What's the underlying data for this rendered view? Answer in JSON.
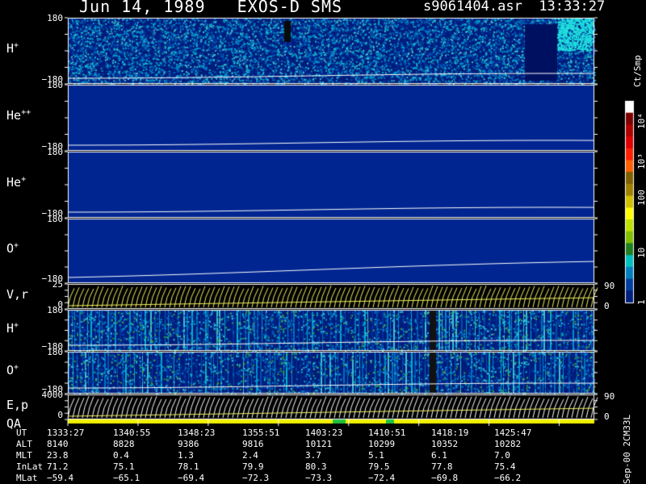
{
  "header": {
    "title": "Jun 14, 1989   EXOS-D SMS",
    "file": "s9061404.asr",
    "time": "13:33:27"
  },
  "panels": [
    {
      "label": "H",
      "sup": "+",
      "top": "180",
      "bottom": "−180",
      "type": "spectrogram",
      "style": "noisy"
    },
    {
      "label": "He",
      "sup": "++",
      "top": "180",
      "bottom": "−180",
      "type": "spectrogram",
      "style": "flat"
    },
    {
      "label": "He",
      "sup": "+",
      "top": "180",
      "bottom": "−180",
      "type": "spectrogram",
      "style": "flat"
    },
    {
      "label": "O",
      "sup": "+",
      "top": "180",
      "bottom": "−180",
      "type": "spectrogram",
      "style": "flat"
    },
    {
      "label": "V,r",
      "sup": "",
      "top": "25",
      "bottom": "0",
      "right_top": "90",
      "right_bottom": "0",
      "type": "lines"
    },
    {
      "label": "H",
      "sup": "+",
      "top": "180",
      "bottom": "−180",
      "type": "spectrogram",
      "style": "striped"
    },
    {
      "label": "O",
      "sup": "+",
      "top": "180",
      "bottom": "−180",
      "type": "spectrogram",
      "style": "striped"
    },
    {
      "label": "E,p",
      "sup": "",
      "label2": "QA",
      "top": "4000",
      "bottom": "0",
      "right_top": "90",
      "right_bottom": "0",
      "type": "lines"
    }
  ],
  "colorbar": {
    "units": "Ct/Smp",
    "labels": [
      "10⁴",
      "10³",
      "100",
      "10",
      "1"
    ],
    "colors": [
      "#ffffff",
      "#800000",
      "#b00000",
      "#e00000",
      "#ff2000",
      "#ff6000",
      "#806000",
      "#a08000",
      "#d0c000",
      "#ffff00",
      "#c0e000",
      "#80c000",
      "#208020",
      "#00c0c0",
      "#0080c0",
      "#0040a0",
      "#002080"
    ]
  },
  "ephemeris": {
    "names": [
      "UT",
      "ALT",
      "MLT",
      "InLat",
      "MLat"
    ],
    "rows": [
      [
        "1333:27",
        "1340:55",
        "1348:23",
        "1355:51",
        "1403:23",
        "1410:51",
        "1418:19",
        "1425:47"
      ],
      [
        "8140",
        "8828",
        "9386",
        "9816",
        "10121",
        "10299",
        "10352",
        "10282"
      ],
      [
        "23.8",
        "0.4",
        "1.3",
        "2.4",
        "3.7",
        "5.1",
        "6.1",
        "7.0"
      ],
      [
        "71.2",
        "75.1",
        "78.1",
        "79.9",
        "80.3",
        "79.5",
        "77.8",
        "75.4"
      ],
      [
        "−59.4",
        "−65.1",
        "−69.4",
        "−72.3",
        "−73.3",
        "−72.4",
        "−69.8",
        "−66.2"
      ]
    ]
  },
  "footer": "Sep-00 2CM33L",
  "chart_data": {
    "type": "heatmap",
    "title": "Jun 14, 1989   EXOS-D SMS",
    "x_ticks": [
      "1333:27",
      "1340:55",
      "1348:23",
      "1355:51",
      "1403:23",
      "1410:51",
      "1418:19",
      "1425:47"
    ],
    "series": [
      {
        "name": "H+",
        "ylim": [
          -180,
          180
        ]
      },
      {
        "name": "He++",
        "ylim": [
          -180,
          180
        ]
      },
      {
        "name": "He+",
        "ylim": [
          -180,
          180
        ]
      },
      {
        "name": "O+",
        "ylim": [
          -180,
          180
        ]
      },
      {
        "name": "V,r",
        "ylim": [
          0,
          25
        ]
      },
      {
        "name": "H+",
        "ylim": [
          -180,
          180
        ]
      },
      {
        "name": "O+",
        "ylim": [
          -180,
          180
        ]
      },
      {
        "name": "E,p",
        "ylim": [
          0,
          4000
        ]
      }
    ],
    "colorbar_range": [
      1,
      10000
    ]
  }
}
